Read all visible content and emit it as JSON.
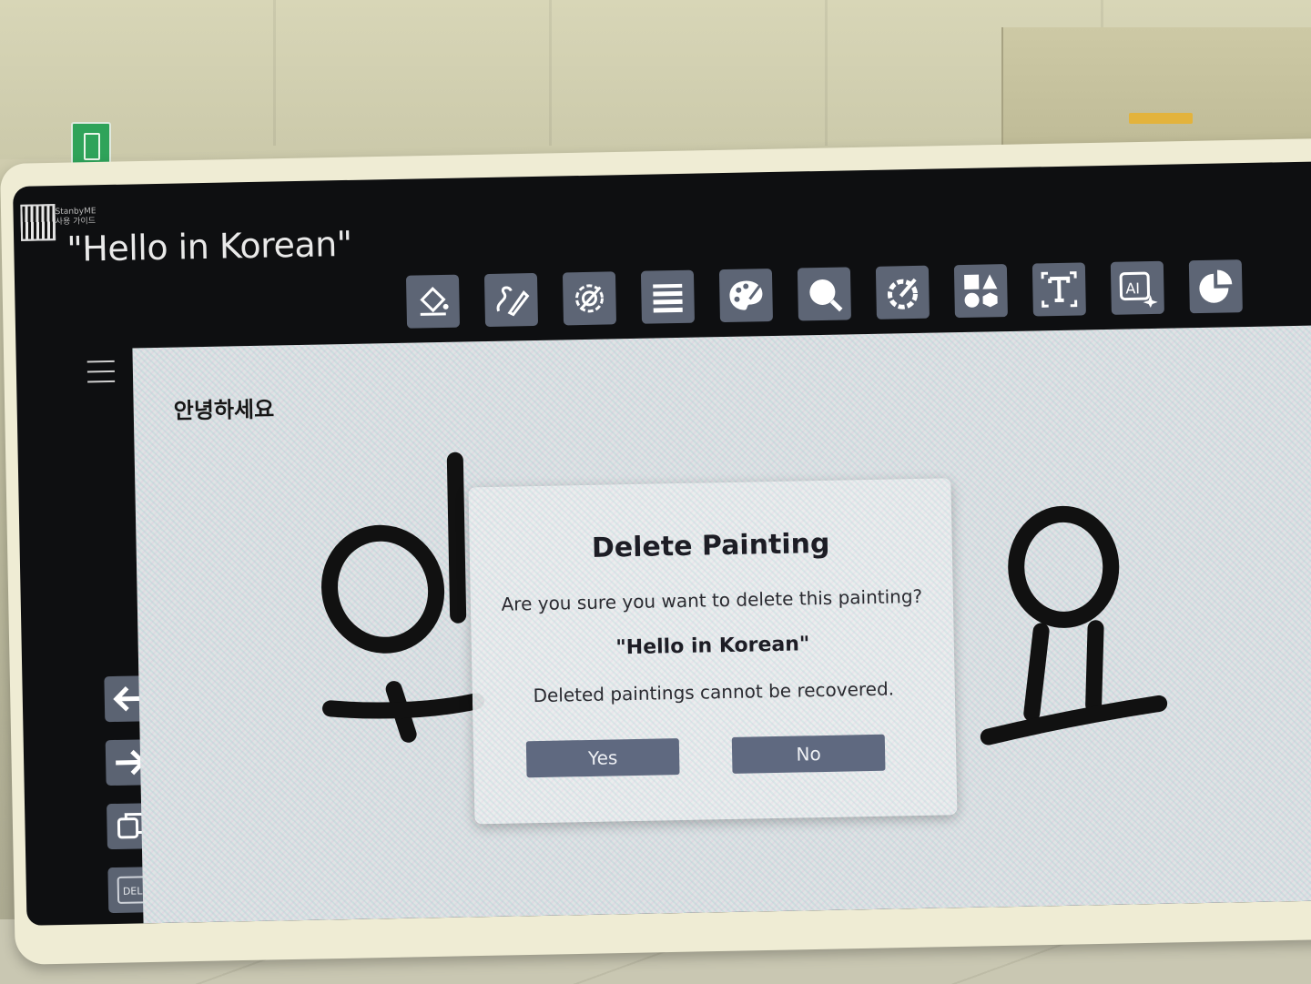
{
  "header": {
    "title": "\"Hello in Korean\""
  },
  "qr_caption": {
    "line1": "StanbyME",
    "line2": "사용 가이드"
  },
  "toolbar": {
    "tools": [
      {
        "name": "fill-icon"
      },
      {
        "name": "pen-icon"
      },
      {
        "name": "brush-settings-icon"
      },
      {
        "name": "line-thickness-icon"
      },
      {
        "name": "palette-icon"
      },
      {
        "name": "magnify-icon"
      },
      {
        "name": "color-picker-icon"
      },
      {
        "name": "shapes-icon"
      },
      {
        "name": "text-icon"
      },
      {
        "name": "ai-icon"
      },
      {
        "name": "pie-icon"
      }
    ]
  },
  "sidebar": {
    "menu_icon": "hamburger-icon",
    "undo_icon": "arrow-left-icon",
    "redo_icon": "arrow-right-icon",
    "copy_icon": "copy-icon",
    "delete_label": "DEL"
  },
  "canvas": {
    "label": "안녕하세요"
  },
  "dialog": {
    "title": "Delete Painting",
    "message": "Are you sure you want to delete this painting?",
    "painting_name": "\"Hello in Korean\"",
    "note": "Deleted paintings cannot be recovered.",
    "yes_label": "Yes",
    "no_label": "No"
  },
  "colors": {
    "tool_bg": "#5d6575",
    "dialog_button": "#5f6980",
    "screen_bg": "#0e0f11"
  }
}
